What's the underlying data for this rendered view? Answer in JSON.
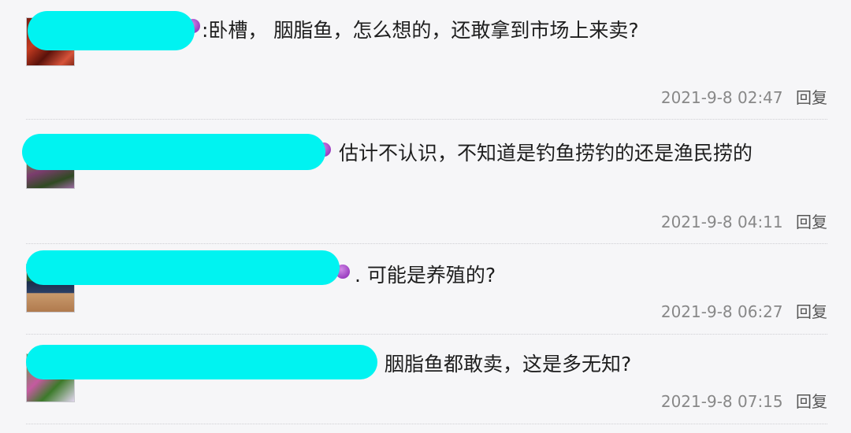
{
  "comments": [
    {
      "text": ":卧槽， 胭脂鱼，怎么想的，还敢拿到市场上来卖?",
      "date": "2021-9-8 02:47",
      "reply": "回复"
    },
    {
      "text": "估计不认识，不知道是钓鱼捞钓的还是渔民捞的",
      "date": "2021-9-8 04:11",
      "reply": "回复"
    },
    {
      "text": ". 可能是养殖的?",
      "date": "2021-9-8 06:27",
      "reply": "回复"
    },
    {
      "text": "胭脂鱼都敢卖，这是多无知?",
      "date": "2021-9-8 07:15",
      "reply": "回复"
    }
  ],
  "colors": {
    "redaction_mask": "#00f3f1",
    "background": "#f6f6f8"
  },
  "icons": {
    "emoji": "purple-devil-emoji-icon"
  }
}
